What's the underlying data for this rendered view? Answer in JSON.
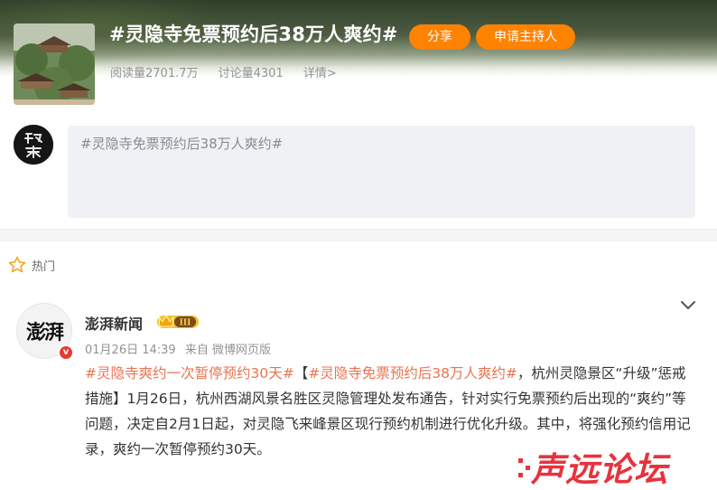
{
  "topic": {
    "title": "#灵隐寺免票预约后38万人爽约#",
    "share_label": "分享",
    "host_label": "申请主持人",
    "reads": "阅读量2701.7万",
    "discussions": "讨论量4301",
    "details": "详情>"
  },
  "composer": {
    "text": "#灵隐寺免票预约后38万人爽约#"
  },
  "hot": {
    "label": "热门"
  },
  "post": {
    "avatar_text": "澎湃",
    "verify_mark": "v",
    "author": "澎湃新闻",
    "vip_level": "III",
    "date": "01月26日 14:39",
    "source": "来自 微博网页版",
    "tag1": "#灵隐寺爽约一次暂停预约30天#",
    "bracket_open": "【",
    "tag2": "#灵隐寺免票预约后38万人爽约#",
    "text_after": "，杭州灵隐景区“升级”惩戒措施】1月26日，杭州西湖风景名胜区灵隐管理处发布通告，针对实行免票预约后出现的“爽约”等问题，决定自2月1日起，对灵隐飞来峰景区现行预约机制进行优化升级。其中，将强化预约信用记录，爽约一次暂停预约30天。"
  },
  "watermark": {
    "text": "声远论坛"
  },
  "colors": {
    "accent": "#ff8200",
    "link": "#eb7350",
    "verify": "#e63b2e",
    "watermark": "#e8323d"
  }
}
